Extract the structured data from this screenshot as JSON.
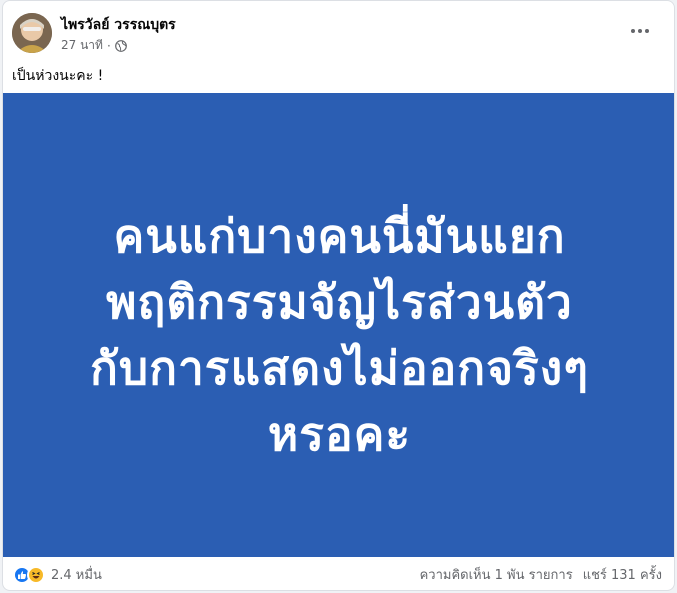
{
  "post": {
    "author": "ไพรวัลย์ วรรณบุตร",
    "time": "27 นาที",
    "separator": "·",
    "privacy_icon": "globe-icon",
    "caption": "เป็นห่วงนะคะ !",
    "image": {
      "background": "#2b5eb3",
      "lines": [
        "คนแก่บางคนนี่มันแยก",
        "พฤติกรรมจัญไรส่วนตัว",
        "กับการแสดงไม่ออกจริงๆ",
        "หรอคะ"
      ]
    },
    "footer": {
      "reaction_icons": [
        "like-icon",
        "haha-icon"
      ],
      "reactions_count": "2.4 หมื่น",
      "comments": "ความคิดเห็น 1 พัน รายการ",
      "shares": "แชร์ 131 ครั้ง"
    }
  },
  "colors": {
    "accent": "#1877f2",
    "haha": "#f7b928",
    "secondary_text": "#65676b"
  }
}
